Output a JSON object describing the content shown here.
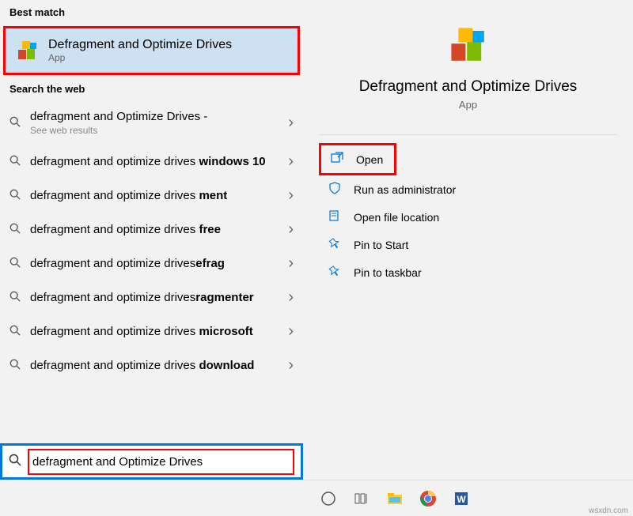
{
  "left": {
    "best_match_header": "Best match",
    "best_match": {
      "title": "Defragment and Optimize Drives",
      "sub": "App"
    },
    "search_web_header": "Search the web",
    "items": [
      {
        "prefix": "defragment and Optimize Drives -",
        "bold": "",
        "sub": "See web results"
      },
      {
        "prefix": "defragment and optimize drives ",
        "bold": "windows 10",
        "sub": ""
      },
      {
        "prefix": "defragment and optimize drives ",
        "bold": "ment",
        "sub": ""
      },
      {
        "prefix": "defragment and optimize drives ",
        "bold": "free",
        "sub": ""
      },
      {
        "prefix": "defragment and optimize drives",
        "bold": "efrag",
        "sub": ""
      },
      {
        "prefix": "defragment and optimize drives",
        "bold": "ragmenter",
        "sub": ""
      },
      {
        "prefix": "defragment and optimize drives ",
        "bold": "microsoft",
        "sub": ""
      },
      {
        "prefix": "defragment and optimize drives ",
        "bold": "download",
        "sub": ""
      }
    ],
    "search_value": "defragment and Optimize Drives"
  },
  "right": {
    "title": "Defragment and Optimize Drives",
    "sub": "App",
    "actions": {
      "open": "Open",
      "run_admin": "Run as administrator",
      "open_loc": "Open file location",
      "pin_start": "Pin to Start",
      "pin_taskbar": "Pin to taskbar"
    }
  },
  "watermark": "wsxdn.com"
}
